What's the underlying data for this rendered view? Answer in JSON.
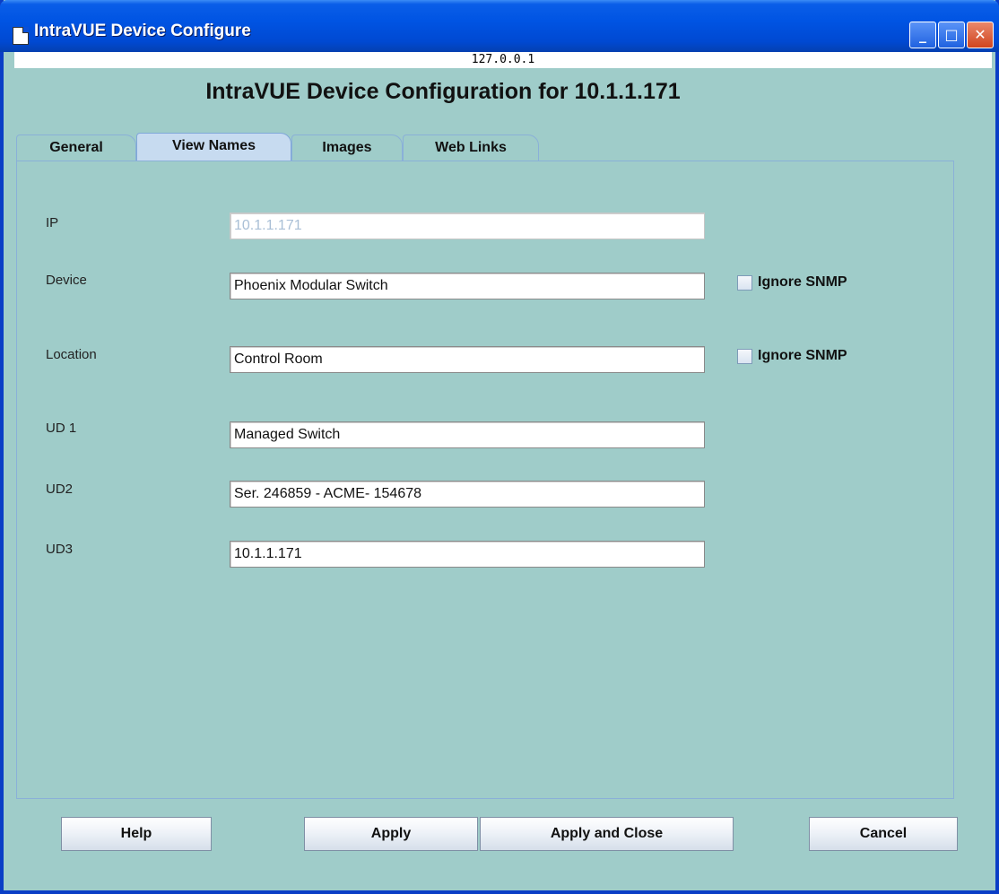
{
  "window": {
    "title": "IntraVUE Device Configure",
    "host": "127.0.0.1",
    "controls": {
      "minimize": "_",
      "maximize": "□",
      "close": "✕"
    }
  },
  "heading": "IntraVUE Device Configuration for 10.1.1.171",
  "tabs": [
    "General",
    "View Names",
    "Images",
    "Web Links"
  ],
  "active_tab": "View Names",
  "form": {
    "ip": {
      "label": "IP",
      "value": "10.1.1.171"
    },
    "device": {
      "label": "Device",
      "value": "Phoenix Modular Switch",
      "checkbox_label": "Ignore SNMP"
    },
    "location": {
      "label": "Location",
      "value": "Control Room",
      "checkbox_label": "Ignore SNMP"
    },
    "ud1": {
      "label": "UD 1",
      "value": "Managed Switch"
    },
    "ud2": {
      "label": "UD2",
      "value": "Ser. 246859 - ACME- 154678"
    },
    "ud3": {
      "label": "UD3",
      "value": "10.1.1.171"
    }
  },
  "buttons": {
    "help": "Help",
    "apply": "Apply",
    "apply_close": "Apply and Close",
    "cancel": "Cancel"
  },
  "icons": {
    "app": "document-icon"
  }
}
